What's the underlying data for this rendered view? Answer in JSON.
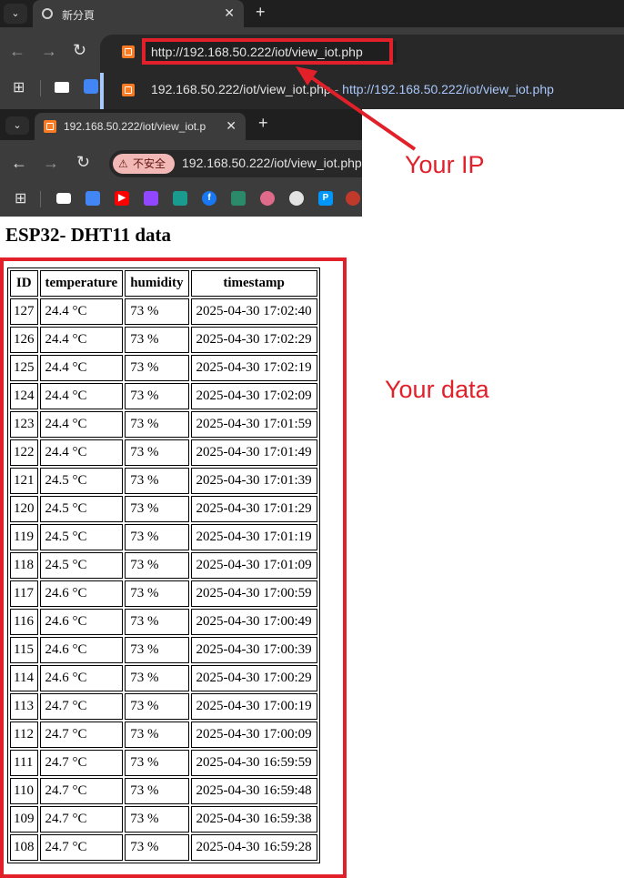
{
  "browser_top": {
    "tab_title": "新分頁",
    "url_input": "http://192.168.50.222/iot/view_iot.php",
    "suggestion": {
      "primary": "192.168.50.222/iot/view_iot.php",
      "separator": " - ",
      "link": "http://192.168.50.222/iot/view_iot.php"
    }
  },
  "browser_second": {
    "tab_title": "192.168.50.222/iot/view_iot.p",
    "security_label": "不安全",
    "url": "192.168.50.222/iot/view_iot.php",
    "bookmarks": [
      "apps-icon",
      "gmail-icon",
      "translate-icon",
      "youtube-icon",
      "twitch-icon",
      "dolphin-icon",
      "facebook-icon",
      "link-icon",
      "bubble-icon",
      "openai-icon",
      "pixiv-icon",
      "counter-icon"
    ]
  },
  "page": {
    "title": "ESP32- DHT11 data",
    "columns": [
      "ID",
      "temperature",
      "humidity",
      "timestamp"
    ],
    "rows": [
      [
        "127",
        "24.4 °C",
        "73 %",
        "2025-04-30 17:02:40"
      ],
      [
        "126",
        "24.4 °C",
        "73 %",
        "2025-04-30 17:02:29"
      ],
      [
        "125",
        "24.4 °C",
        "73 %",
        "2025-04-30 17:02:19"
      ],
      [
        "124",
        "24.4 °C",
        "73 %",
        "2025-04-30 17:02:09"
      ],
      [
        "123",
        "24.4 °C",
        "73 %",
        "2025-04-30 17:01:59"
      ],
      [
        "122",
        "24.4 °C",
        "73 %",
        "2025-04-30 17:01:49"
      ],
      [
        "121",
        "24.5 °C",
        "73 %",
        "2025-04-30 17:01:39"
      ],
      [
        "120",
        "24.5 °C",
        "73 %",
        "2025-04-30 17:01:29"
      ],
      [
        "119",
        "24.5 °C",
        "73 %",
        "2025-04-30 17:01:19"
      ],
      [
        "118",
        "24.5 °C",
        "73 %",
        "2025-04-30 17:01:09"
      ],
      [
        "117",
        "24.6 °C",
        "73 %",
        "2025-04-30 17:00:59"
      ],
      [
        "116",
        "24.6 °C",
        "73 %",
        "2025-04-30 17:00:49"
      ],
      [
        "115",
        "24.6 °C",
        "73 %",
        "2025-04-30 17:00:39"
      ],
      [
        "114",
        "24.6 °C",
        "73 %",
        "2025-04-30 17:00:29"
      ],
      [
        "113",
        "24.7 °C",
        "73 %",
        "2025-04-30 17:00:19"
      ],
      [
        "112",
        "24.7 °C",
        "73 %",
        "2025-04-30 17:00:09"
      ],
      [
        "111",
        "24.7 °C",
        "73 %",
        "2025-04-30 16:59:59"
      ],
      [
        "110",
        "24.7 °C",
        "73 %",
        "2025-04-30 16:59:48"
      ],
      [
        "109",
        "24.7 °C",
        "73 %",
        "2025-04-30 16:59:38"
      ],
      [
        "108",
        "24.7 °C",
        "73 %",
        "2025-04-30 16:59:28"
      ]
    ]
  },
  "annotations": {
    "ip_label": "Your IP",
    "data_label": "Your data",
    "color": "#e1202a"
  }
}
